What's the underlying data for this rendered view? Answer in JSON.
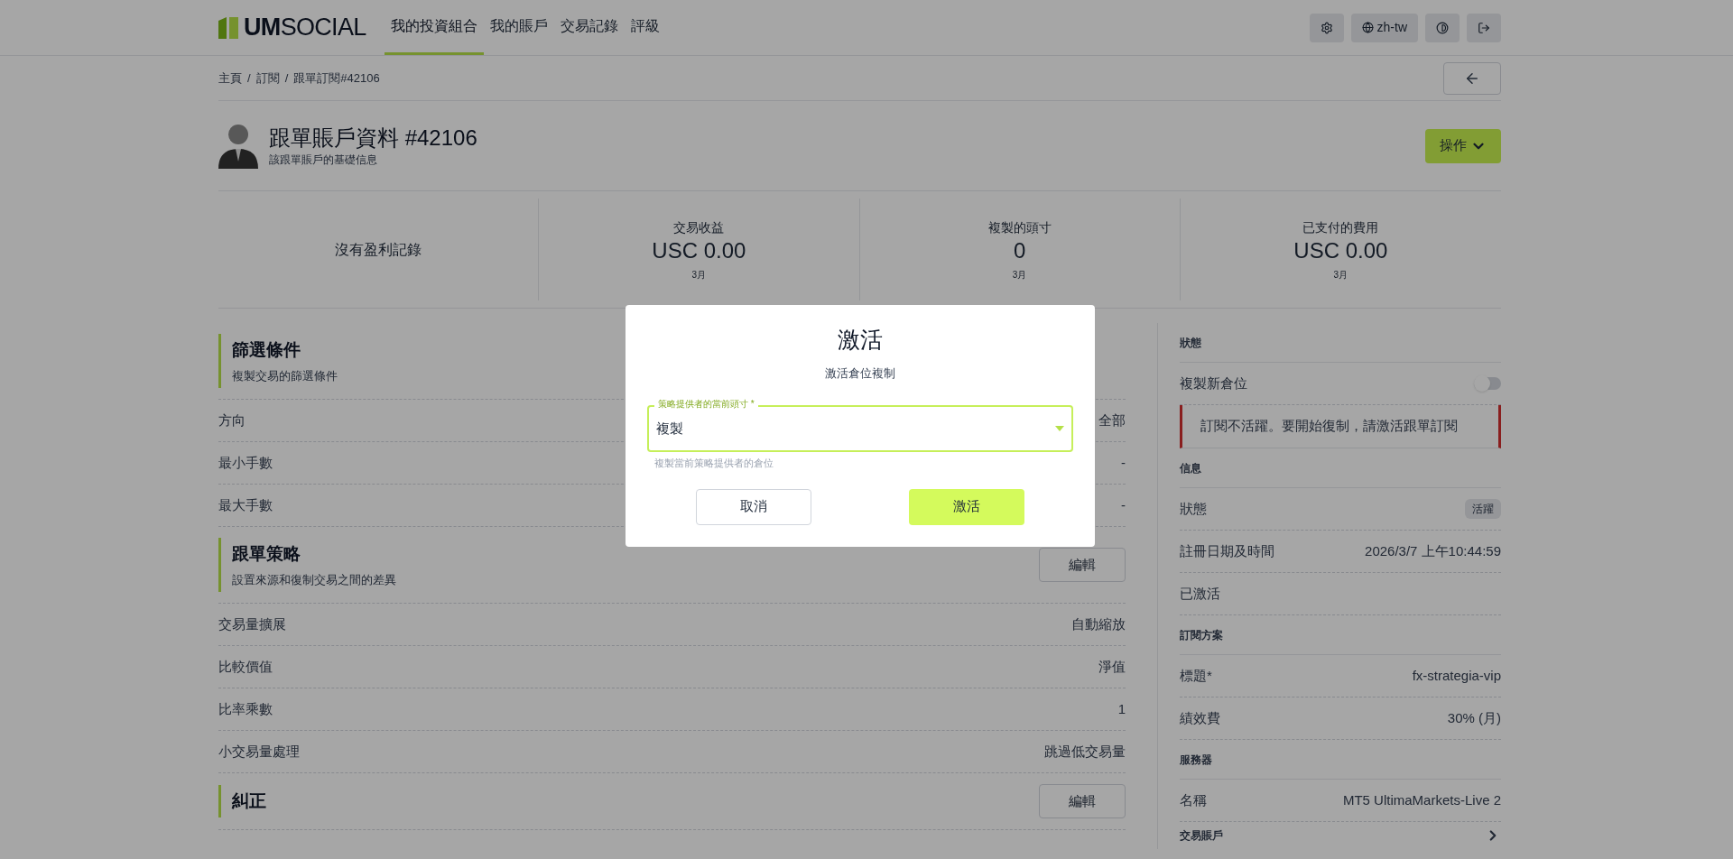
{
  "header": {
    "logo": {
      "bold": "UM",
      "light": "SOCIAL"
    },
    "nav": [
      {
        "label": "我的投資組合",
        "selected": true
      },
      {
        "label": "我的賬戶",
        "selected": false
      },
      {
        "label": "交易記錄",
        "selected": false
      },
      {
        "label": "評級",
        "selected": false
      }
    ],
    "language": "zh-tw"
  },
  "breadcrumb": {
    "separator": "/",
    "items": [
      "主頁",
      "訂閱",
      "跟單訂閱#42106"
    ]
  },
  "profile": {
    "title": "跟單賬戶資料 #42106",
    "subtitle": "該跟單賬戶的基礎信息",
    "action": "操作"
  },
  "stats": {
    "empty": "沒有盈利記錄",
    "items": [
      {
        "label": "交易收益",
        "value": "USC 0.00",
        "period": "3月"
      },
      {
        "label": "複製的頭寸",
        "value": "0",
        "period": "3月"
      },
      {
        "label": "已支付的費用",
        "value": "USC 0.00",
        "period": "3月"
      }
    ]
  },
  "sections": [
    {
      "title": "篩選條件",
      "subtitle": "複製交易的篩選條件",
      "rows": [
        {
          "label": "方向",
          "value": "全部"
        },
        {
          "label": "最小手數",
          "value": "-"
        },
        {
          "label": "最大手數",
          "value": "-"
        }
      ]
    },
    {
      "title": "跟單策略",
      "subtitle": "設置來源和復制交易之間的差異",
      "edit": "編輯",
      "rows": [
        {
          "label": "交易量擴展",
          "value": "自動縮放"
        },
        {
          "label": "比較價值",
          "value": "淨值"
        },
        {
          "label": "比率乘數",
          "value": "1"
        },
        {
          "label": "小交易量處理",
          "value": "跳過低交易量"
        }
      ]
    },
    {
      "title": "糾正",
      "edit": "編輯"
    }
  ],
  "side": [
    {
      "kind": "heading",
      "label": "狀態"
    },
    {
      "kind": "toggle",
      "label": "複製新倉位",
      "on": false
    },
    {
      "kind": "alert",
      "text": "訂閱不活躍。要開始復制，請激活跟單訂閱"
    },
    {
      "kind": "heading",
      "label": "信息"
    },
    {
      "kind": "badge",
      "label": "狀態",
      "value": "活躍"
    },
    {
      "kind": "row",
      "label": "註冊日期及時間",
      "value": "2026/3/7 上午10:44:59"
    },
    {
      "kind": "row",
      "label": "已激活"
    },
    {
      "kind": "heading",
      "label": "訂閱方案"
    },
    {
      "kind": "row",
      "label": "標題*",
      "value": "fx-strategia-vip"
    },
    {
      "kind": "row",
      "label": "績效費",
      "value": "30% (月)"
    },
    {
      "kind": "heading",
      "label": "服務器"
    },
    {
      "kind": "row",
      "label": "名稱",
      "value": "MT5 UltimaMarkets-Live 2"
    },
    {
      "kind": "link",
      "label": "交易賬戶"
    }
  ],
  "dialog": {
    "title": "激活",
    "subtitle": "激活倉位複制",
    "field": {
      "label": "策略提供者的當前頭寸 *",
      "value": "複製",
      "hint": "複製當前策略提供者的倉位"
    },
    "cancel": "取消",
    "confirm": "激活"
  }
}
